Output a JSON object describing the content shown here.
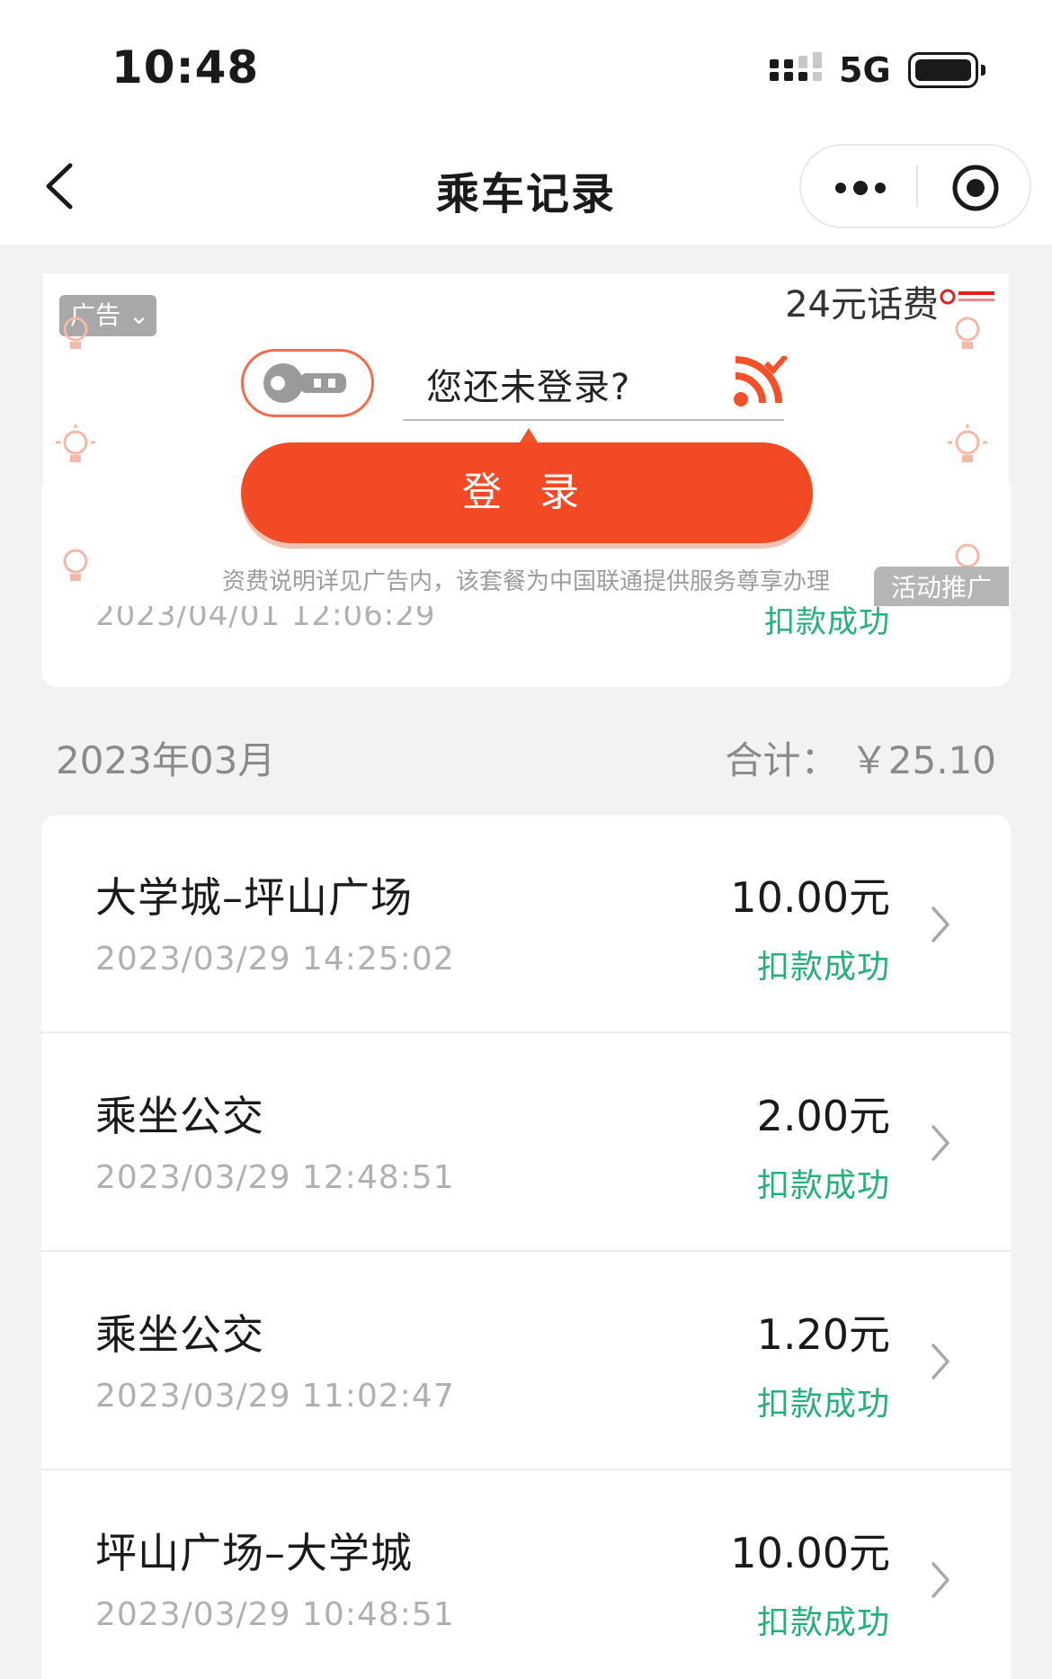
{
  "status_bar": {
    "time": "10:48",
    "network": "5G"
  },
  "nav": {
    "title": "乘车记录"
  },
  "ad": {
    "tag": "广告",
    "prize": "24元话费",
    "question": "您还未登录?",
    "login_button": "登 录",
    "note": "资费说明详见广告内，该套餐为中国联通提供服务尊享办理",
    "promo_tag": "活动推广"
  },
  "previous_record": {
    "date": "2023/04/01 12:06:29",
    "status": "扣款成功"
  },
  "month_group": {
    "label": "2023年03月",
    "total": "合计： ￥25.10"
  },
  "records": [
    {
      "title": "大学城–坪山广场",
      "date": "2023/03/29 14:25:02",
      "amount": "10.00元",
      "status": "扣款成功"
    },
    {
      "title": "乘坐公交",
      "date": "2023/03/29 12:48:51",
      "amount": "2.00元",
      "status": "扣款成功"
    },
    {
      "title": "乘坐公交",
      "date": "2023/03/29 11:02:47",
      "amount": "1.20元",
      "status": "扣款成功"
    },
    {
      "title": "坪山广场–大学城",
      "date": "2023/03/29 10:48:51",
      "amount": "10.00元",
      "status": "扣款成功"
    }
  ],
  "colors": {
    "success": "#23b07a",
    "ad_accent": "#f24a25",
    "background": "#f2f2f2"
  }
}
